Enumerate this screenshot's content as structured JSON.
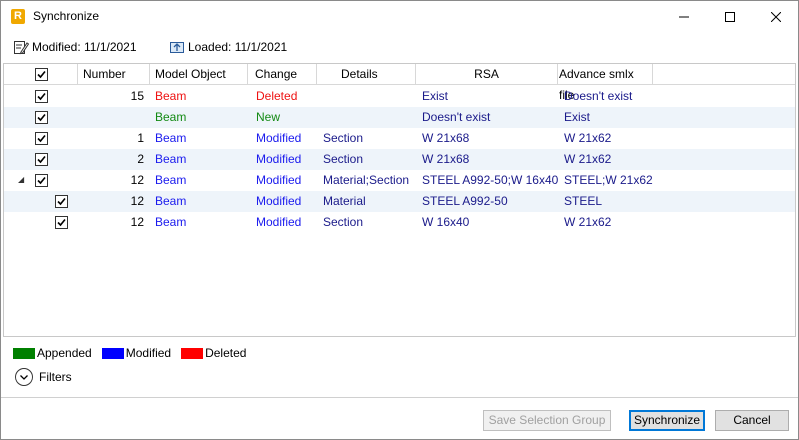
{
  "window": {
    "title": "Synchronize",
    "app_icon_letter": "R",
    "app_icon_color": "#f0a800"
  },
  "info": {
    "modified": "Modified: 11/1/2021",
    "loaded": "Loaded: 11/1/2021"
  },
  "grid": {
    "columns": [
      "Number",
      "Model Object",
      "Change",
      "Details",
      "RSA",
      "Advance smlx file"
    ],
    "rows": [
      {
        "checked": true,
        "number": "15",
        "object": "Beam",
        "change": "Deleted",
        "details": "",
        "rsa": "Exist",
        "advance": "Doesn't exist",
        "object_color": "red",
        "change_color": "red"
      },
      {
        "checked": true,
        "number": "",
        "object": "Beam",
        "change": "New",
        "details": "",
        "rsa": "Doesn't exist",
        "advance": "Exist",
        "object_color": "green",
        "change_color": "green"
      },
      {
        "checked": true,
        "number": "1",
        "object": "Beam",
        "change": "Modified",
        "details": "Section",
        "rsa": "W 21x68",
        "advance": "W 21x62",
        "object_color": "blue",
        "change_color": "blue"
      },
      {
        "checked": true,
        "number": "2",
        "object": "Beam",
        "change": "Modified",
        "details": "Section",
        "rsa": "W 21x68",
        "advance": "W 21x62",
        "object_color": "blue",
        "change_color": "blue"
      },
      {
        "checked": true,
        "number": "12",
        "object": "Beam",
        "change": "Modified",
        "details": "Material;Section",
        "rsa": "STEEL A992-50;W 16x40",
        "advance": "STEEL;W 21x62",
        "object_color": "blue",
        "change_color": "blue",
        "expanded": true
      },
      {
        "checked": true,
        "number": "12",
        "object": "Beam",
        "change": "Modified",
        "details": "Material",
        "rsa": "STEEL A992-50",
        "advance": "STEEL",
        "object_color": "blue",
        "change_color": "blue",
        "child": true
      },
      {
        "checked": true,
        "number": "12",
        "object": "Beam",
        "change": "Modified",
        "details": "Section",
        "rsa": "W 16x40",
        "advance": "W 21x62",
        "object_color": "blue",
        "change_color": "blue",
        "child": true
      }
    ]
  },
  "legend": [
    {
      "label": "Appended",
      "color": "#008000"
    },
    {
      "label": "Modified",
      "color": "#0000ff"
    },
    {
      "label": "Deleted",
      "color": "#ff0000"
    }
  ],
  "filters_label": "Filters",
  "buttons": {
    "save_selection_group": "Save Selection Group",
    "synchronize": "Synchronize",
    "cancel": "Cancel"
  },
  "icons": {
    "app": "revit-app-icon",
    "minimize": "minimize-icon",
    "maximize": "maximize-icon",
    "close": "close-icon",
    "modified": "edit-document-icon",
    "loaded": "load-icon",
    "filters": "chevron-down-circle-icon"
  }
}
